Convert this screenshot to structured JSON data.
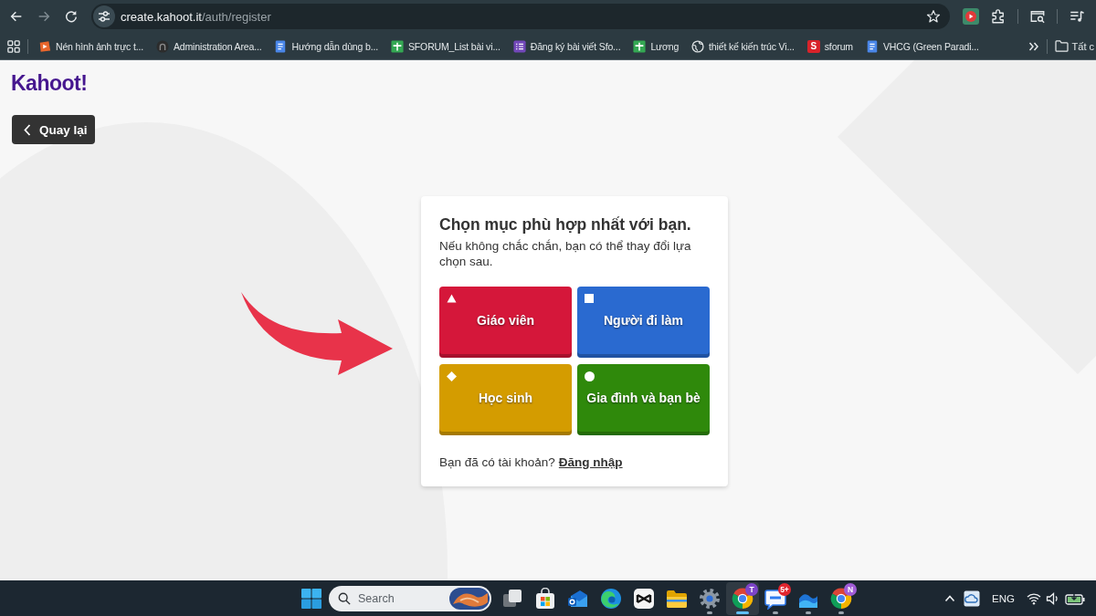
{
  "browser": {
    "nav_buttons": [
      {
        "kind": "back",
        "disabled": false
      },
      {
        "kind": "forward",
        "disabled": true
      },
      {
        "kind": "reload",
        "disabled": false
      }
    ],
    "address_bar": {
      "host": "create.kahoot.it",
      "path": "/auth/register"
    },
    "bookmarks": [
      {
        "kind": "play-image",
        "label": "Nén hình ảnh trực t..."
      },
      {
        "kind": "round-logo",
        "label": "Administration Area..."
      },
      {
        "kind": "doc",
        "label": "Hướng dẫn dùng b..."
      },
      {
        "kind": "sheet",
        "label": "SFORUM_List bài vi..."
      },
      {
        "kind": "form",
        "label": "Đăng ký bài viết Sfo..."
      },
      {
        "kind": "sheet",
        "label": "Lương"
      },
      {
        "kind": "globe",
        "label": "thiết kế kiến trúc Vi..."
      },
      {
        "kind": "letter",
        "letter": "S",
        "label": "sforum"
      },
      {
        "kind": "doc",
        "label": "VHCG (Green Paradi..."
      }
    ],
    "all_bookmarks": {
      "label": "Tất c"
    }
  },
  "page": {
    "logo": "Kahoot!",
    "back_button": {
      "label": "Quay lại"
    },
    "card": {
      "title": "Chọn mục phù hợp nhất với bạn.",
      "subtitle": "Nếu không chắc chắn, bạn có thể thay đổi lựa chọn sau.",
      "options": [
        {
          "kind": "triangle",
          "label": "Giáo viên",
          "color": "#d5173a"
        },
        {
          "kind": "square",
          "label": "Người đi làm",
          "color": "#2a6ad0"
        },
        {
          "kind": "diamond",
          "label": "Học sinh",
          "color": "#d49c00"
        },
        {
          "kind": "circle",
          "label": "Gia đình và bạn bè",
          "color": "#2f890b"
        }
      ],
      "footer": {
        "text": "Bạn đã có tài khoản?",
        "link": "Đăng nhập"
      }
    }
  },
  "taskbar": {
    "search": {
      "placeholder": "Search"
    },
    "apps": [
      {
        "kind": "task-view",
        "running": false,
        "active": false
      },
      {
        "kind": "store",
        "running": false,
        "active": false
      },
      {
        "kind": "mail",
        "running": false,
        "active": false
      },
      {
        "kind": "edge",
        "running": false,
        "active": false
      },
      {
        "kind": "capcut",
        "running": false,
        "active": false
      },
      {
        "kind": "folder",
        "running": false,
        "active": false
      },
      {
        "kind": "settings",
        "running": true,
        "active": false
      },
      {
        "kind": "chrome",
        "running": true,
        "active": true,
        "badge": {
          "text": "T",
          "color": "#7d45c9"
        }
      },
      {
        "kind": "chat",
        "running": true,
        "active": false,
        "badge": {
          "text": "5+",
          "color": "#e1262f"
        }
      },
      {
        "kind": "wave",
        "running": true,
        "active": false
      },
      {
        "kind": "chrome",
        "running": true,
        "active": false,
        "badge": {
          "text": "N",
          "color": "#a05cd6"
        }
      }
    ],
    "language": "ENG"
  }
}
